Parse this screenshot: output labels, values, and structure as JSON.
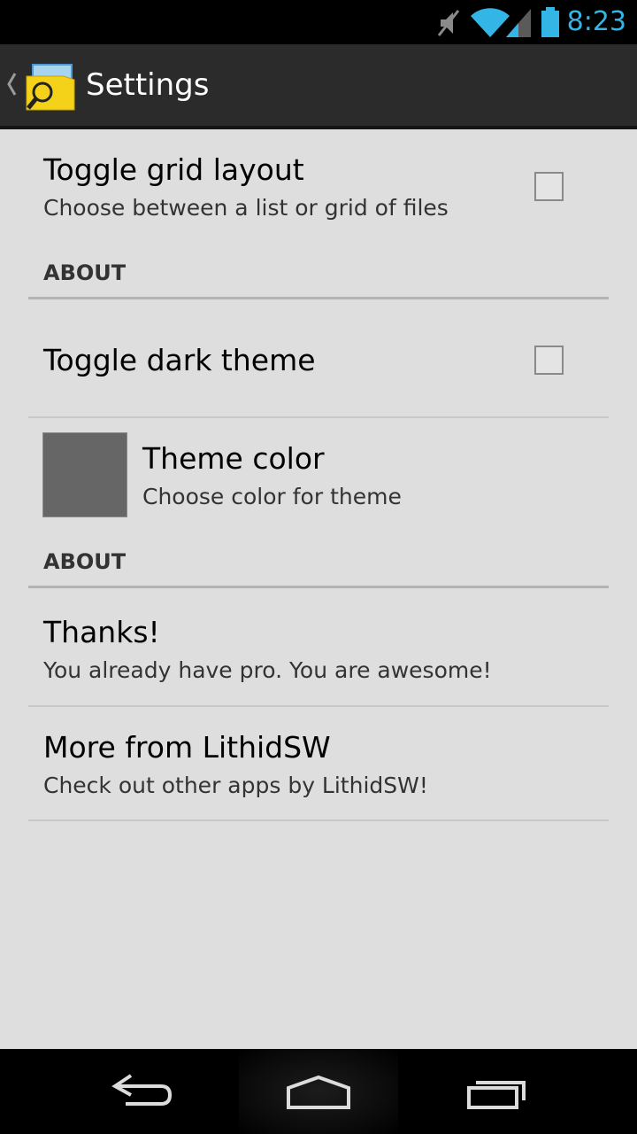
{
  "status_bar": {
    "time": "8:23",
    "icons": [
      "muted-icon",
      "wifi-icon",
      "cell-signal-icon",
      "battery-icon"
    ]
  },
  "action_bar": {
    "title": "Settings",
    "app_icon": "app-folder-search-icon"
  },
  "preferences": {
    "grid_layout": {
      "title": "Toggle grid layout",
      "summary": "Choose between a list or grid of files",
      "checked": false
    },
    "category_1": "ABOUT",
    "dark_theme": {
      "title": "Toggle dark theme",
      "checked": false
    },
    "theme_color": {
      "title": "Theme color",
      "summary": "Choose color for theme",
      "swatch_color": "#666666"
    },
    "category_2": "ABOUT",
    "thanks": {
      "title": "Thanks!",
      "summary": "You already have pro. You are awesome!"
    },
    "more_apps": {
      "title": "More from LithidSW",
      "summary": "Check out other apps by LithidSW!"
    }
  },
  "nav_bar": {
    "buttons": [
      "back-icon",
      "home-icon",
      "recents-icon"
    ]
  },
  "colors": {
    "accent": "#33b5e5",
    "background": "#dedede",
    "action_bar": "#2b2b2b"
  }
}
